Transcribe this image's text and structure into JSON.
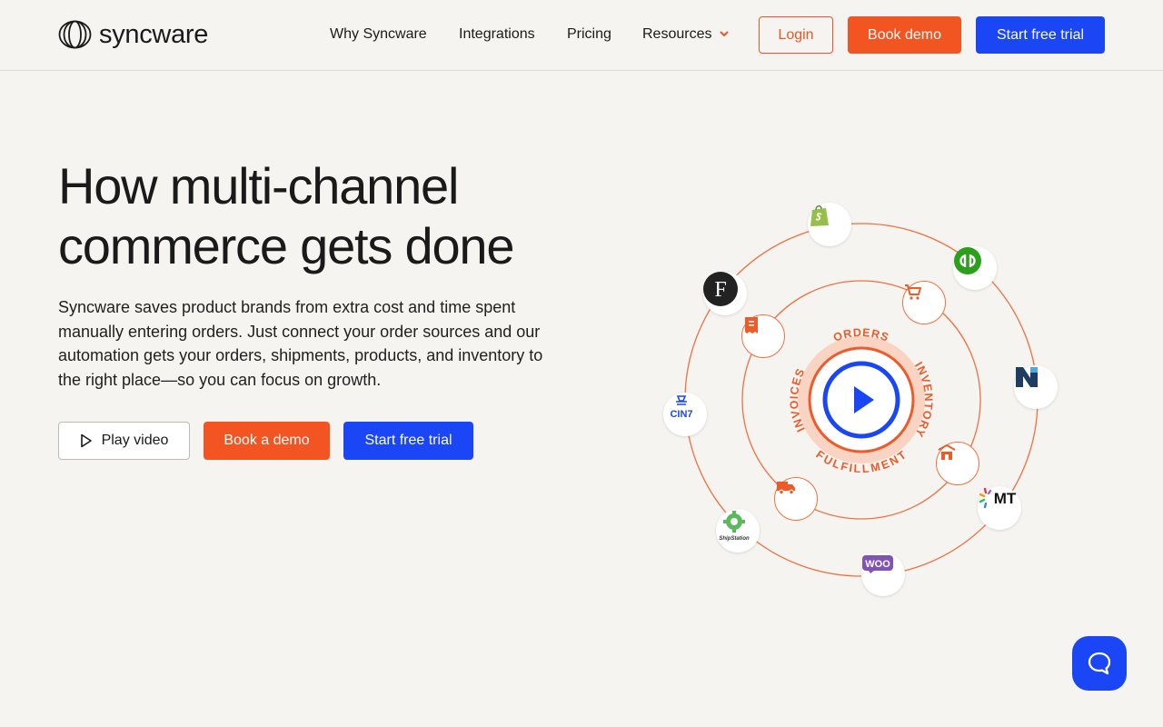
{
  "brand": {
    "name": "syncware"
  },
  "nav": {
    "items": [
      "Why Syncware",
      "Integrations",
      "Pricing",
      "Resources"
    ],
    "login": "Login",
    "book_demo": "Book demo",
    "start_trial": "Start free trial"
  },
  "hero": {
    "title_line1": "How multi-channel",
    "title_line2": "commerce gets done",
    "description": "Syncware saves product brands from extra cost and time spent manually entering orders. Just connect your order sources and our automation gets your orders, shipments, products, and inventory to the right place—so you can focus on growth.",
    "play_video": "Play video",
    "book_demo": "Book a demo",
    "start_trial": "Start free trial"
  },
  "diagram": {
    "ring_labels": [
      "ORDERS",
      "INVENTORY",
      "FULFILLMENT",
      "INVOICES"
    ],
    "integrations": [
      "Shopify",
      "QuickBooks",
      "NetSuite",
      "MT",
      "WooCommerce",
      "ShipStation",
      "CIN7",
      "F"
    ],
    "logo_text": {
      "cin7": "CIN7",
      "woo": "WOO",
      "mt": "MT",
      "f": "F",
      "shipstation": "ShipStation"
    }
  },
  "colors": {
    "accent_orange": "#f25522",
    "accent_blue": "#1a46f5",
    "background": "#f5f4f0"
  }
}
